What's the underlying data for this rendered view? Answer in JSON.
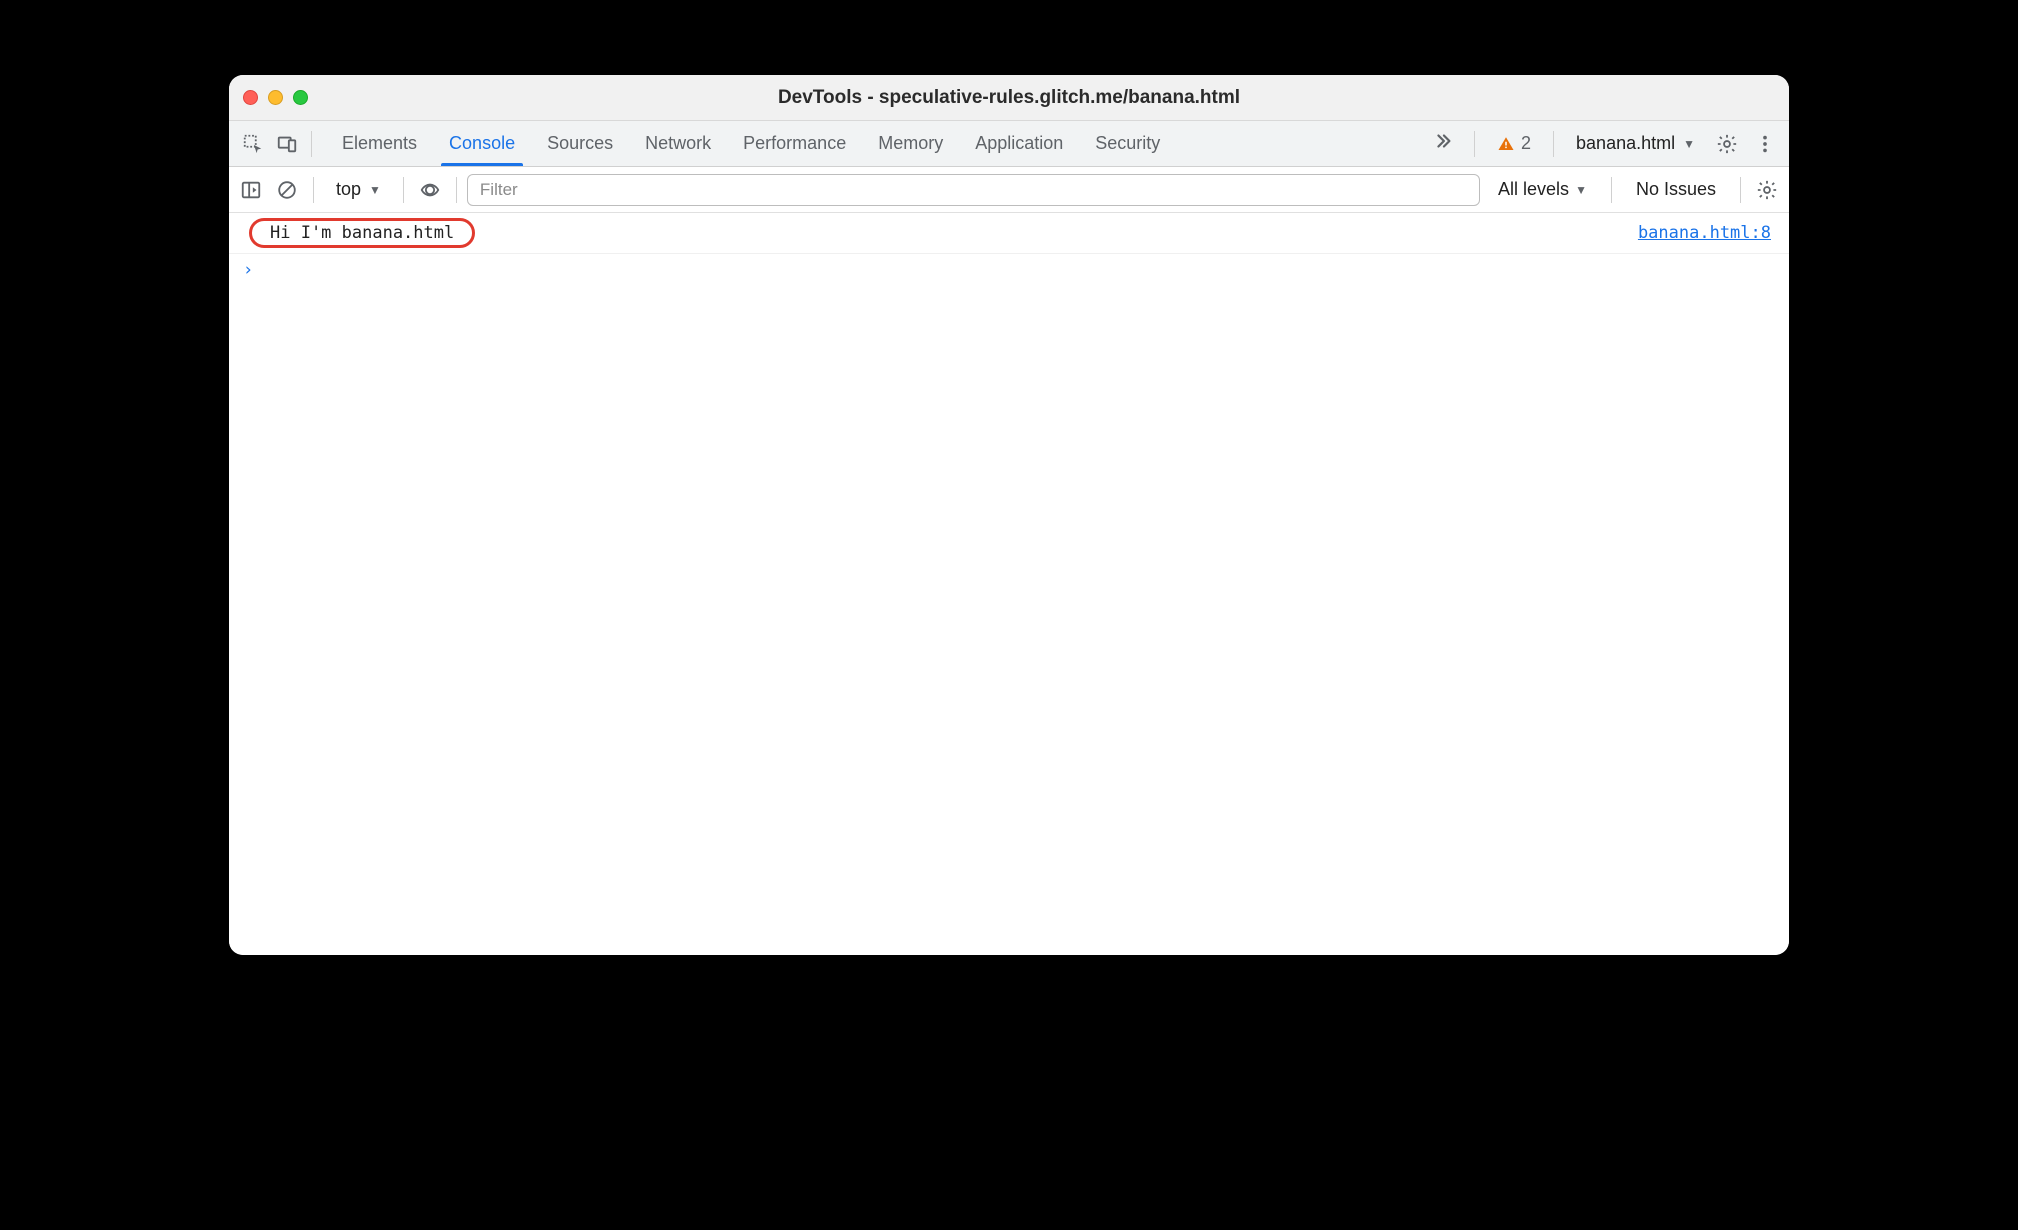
{
  "window": {
    "title": "DevTools - speculative-rules.glitch.me/banana.html"
  },
  "tabs": {
    "items": [
      "Elements",
      "Console",
      "Sources",
      "Network",
      "Performance",
      "Memory",
      "Application",
      "Security"
    ],
    "active_index": 1
  },
  "toolbar_right": {
    "warning_count": "2",
    "target_label": "banana.html"
  },
  "console_toolbar": {
    "context_label": "top",
    "filter_placeholder": "Filter",
    "levels_label": "All levels",
    "issues_label": "No Issues"
  },
  "console": {
    "logs": [
      {
        "message": "Hi I'm banana.html",
        "source": "banana.html:8",
        "highlighted": true
      }
    ]
  }
}
